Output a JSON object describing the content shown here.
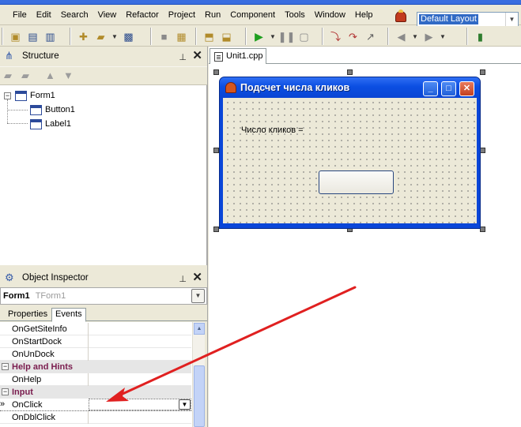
{
  "menu": {
    "items": [
      "File",
      "Edit",
      "Search",
      "View",
      "Refactor",
      "Project",
      "Run",
      "Component",
      "Tools",
      "Window",
      "Help"
    ],
    "layout_selected": "Default Layout"
  },
  "structure": {
    "title": "Structure",
    "tree": {
      "root": "Form1",
      "children": [
        "Button1",
        "Label1"
      ]
    }
  },
  "object_inspector": {
    "title": "Object Inspector",
    "selected_object": "Form1",
    "selected_class": "TForm1",
    "tabs": [
      "Properties",
      "Events"
    ],
    "active_tab": "Events",
    "rows": [
      {
        "kind": "event",
        "name": "OnGetSiteInfo"
      },
      {
        "kind": "event",
        "name": "OnStartDock"
      },
      {
        "kind": "event",
        "name": "OnUnDock"
      },
      {
        "kind": "category",
        "name": "Help and Hints"
      },
      {
        "kind": "event",
        "name": "OnHelp"
      },
      {
        "kind": "category",
        "name": "Input"
      },
      {
        "kind": "event",
        "name": "OnClick",
        "selected": true
      },
      {
        "kind": "event",
        "name": "OnDblClick"
      }
    ],
    "row_marker": "»"
  },
  "editor": {
    "tab_label": "Unit1.cpp"
  },
  "form": {
    "caption": "Подсчет числа кликов",
    "label_text": "Число кликов =",
    "button_caption": ""
  },
  "colors": {
    "xp_titlebar": "#0b4ee2",
    "ide_background": "#ece9d8",
    "category_text": "#7a1c4e",
    "annotation_arrow": "#e02020"
  }
}
